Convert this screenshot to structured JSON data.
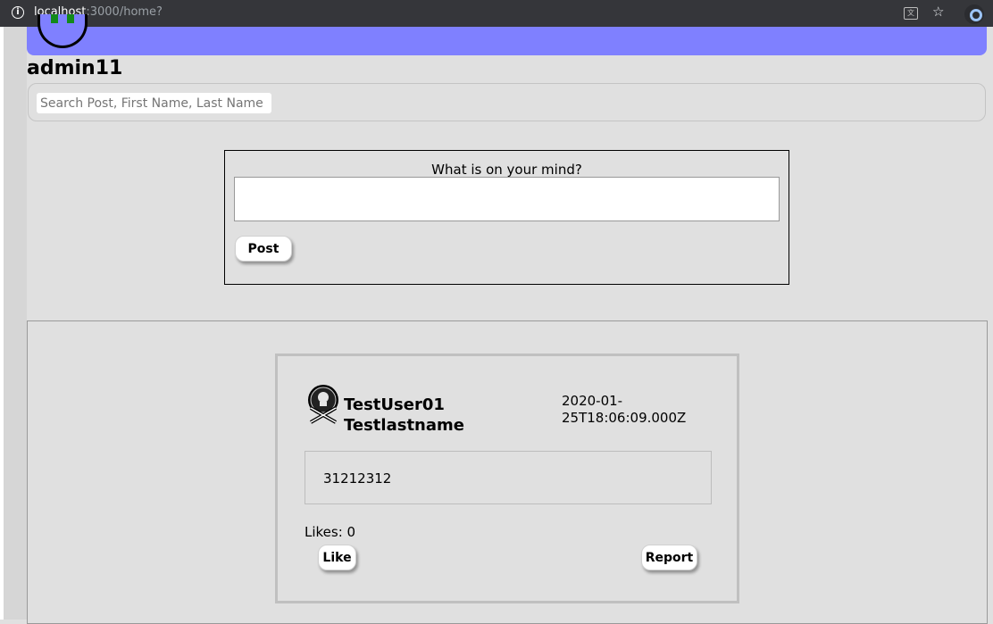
{
  "browser": {
    "url_host": "localhost",
    "url_path": ":3000/home?"
  },
  "user": {
    "username": "admin11"
  },
  "search": {
    "placeholder": "Search Post, First Name, Last Name"
  },
  "compose": {
    "prompt": "What is on your mind?",
    "post_label": "Post"
  },
  "feed": {
    "posts": [
      {
        "first_name": "TestUser01",
        "last_name": "Testlastname",
        "date_line1": "2020-01-",
        "date_line2": "25T18:06:09.000Z",
        "content": "31212312",
        "likes_text": "Likes: 0",
        "like_label": "Like",
        "report_label": "Report"
      }
    ]
  },
  "colors": {
    "header": "#7f80ff",
    "page_bg": "#e0e0e0",
    "logo_accent": "#138a1a"
  }
}
